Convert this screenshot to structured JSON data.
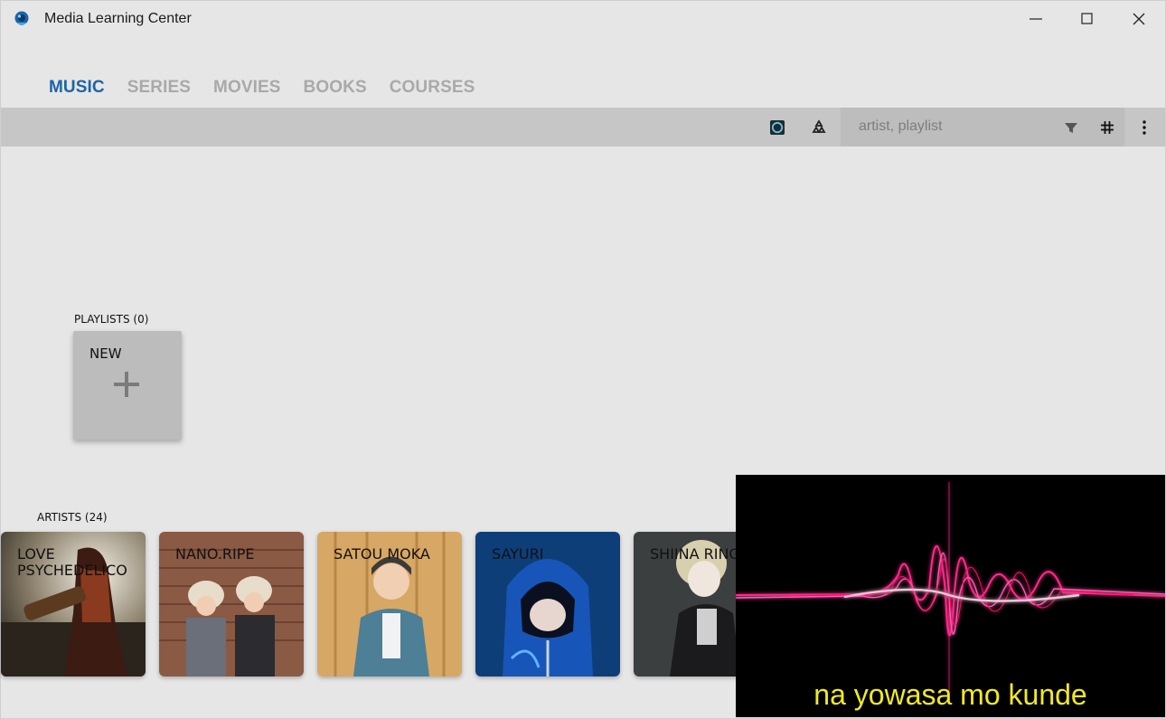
{
  "window": {
    "title": "Media Learning Center"
  },
  "tabs": [
    {
      "label": "MUSIC",
      "active": true
    },
    {
      "label": "SERIES",
      "active": false
    },
    {
      "label": "MOVIES",
      "active": false
    },
    {
      "label": "BOOKS",
      "active": false
    },
    {
      "label": "COURSES",
      "active": false
    }
  ],
  "toolbar": {
    "search_placeholder": "artist, playlist",
    "icons": [
      "record-icon",
      "recycle-icon",
      "filter-icon",
      "hash-icon",
      "more-vert-icon"
    ]
  },
  "playlists": {
    "label": "PLAYLISTS (0)",
    "new_label": "NEW"
  },
  "artists": {
    "label": "ARTISTS (24)",
    "items": [
      {
        "name": "LOVE PSYCHEDELICO"
      },
      {
        "name": "NANO.RIPE"
      },
      {
        "name": "SATOU MOKA"
      },
      {
        "name": "SAYURI"
      },
      {
        "name": "SHIINA RINGO"
      }
    ]
  },
  "player": {
    "lyrics": "na yowasa mo kunde",
    "accent": "#ff2a8a",
    "lyrics_color": "#f2ea1d"
  },
  "colors": {
    "accent": "#1e64a8",
    "tab_inactive": "#a9a9a9",
    "toolbar": "#c6c6c6",
    "background": "#e6e6e6"
  }
}
